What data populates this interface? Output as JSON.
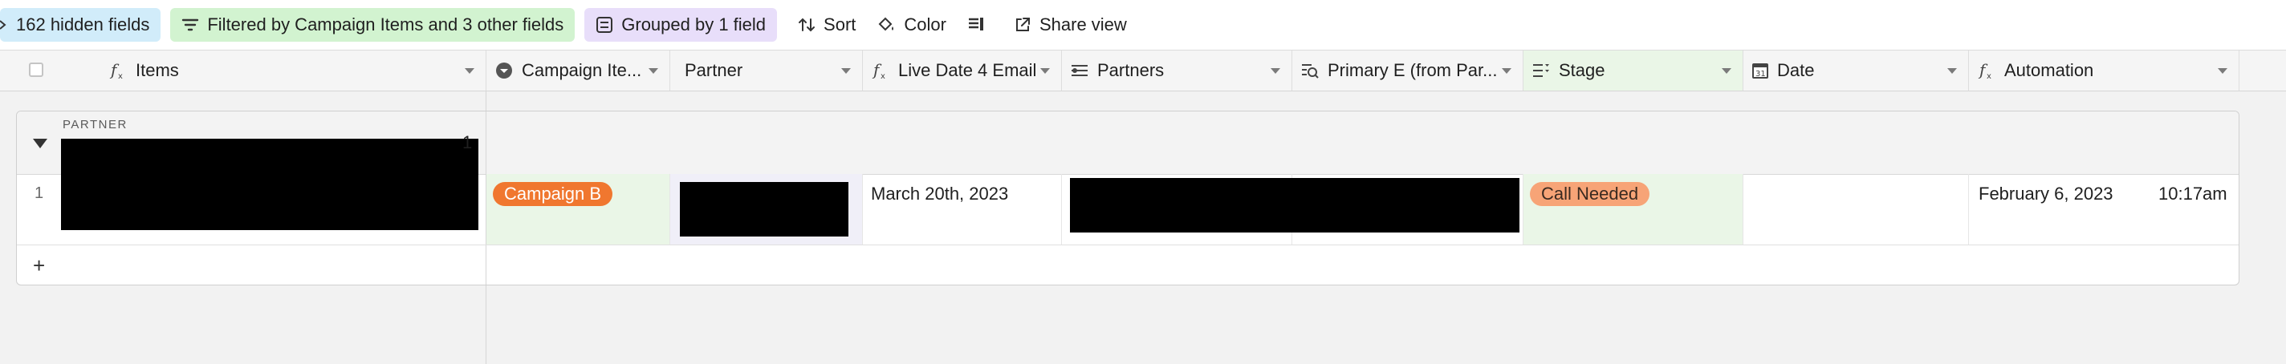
{
  "toolbar": {
    "hidden_fields": "162 hidden fields",
    "filter": "Filtered by Campaign Items and 3 other fields",
    "group": "Grouped by 1 field",
    "sort": "Sort",
    "color": "Color",
    "share": "Share view"
  },
  "columns": [
    {
      "label": "Items",
      "icon": "formula-icon"
    },
    {
      "label": "Campaign Ite...",
      "icon": "dropdown-circle-icon"
    },
    {
      "label": "Partner",
      "icon": ""
    },
    {
      "label": "Live Date 4 Email",
      "icon": "formula-icon"
    },
    {
      "label": "Partners",
      "icon": "linked-records-icon"
    },
    {
      "label": "Primary E (from Par...",
      "icon": "lookup-icon"
    },
    {
      "label": "Stage",
      "icon": "single-select-icon"
    },
    {
      "label": "Date",
      "icon": "calendar-icon"
    },
    {
      "label": "Automation",
      "icon": "formula-icon"
    }
  ],
  "group": {
    "label": "PARTNER",
    "count": "1"
  },
  "row": {
    "number": "1",
    "campaign": "Campaign B",
    "live_date": "March 20th, 2023",
    "stage": "Call Needed",
    "automation_date": "February 6, 2023",
    "automation_time": "10:17am"
  },
  "add_row": "+",
  "colors": {
    "campaign_pill": "#f0772f",
    "stage_pill": "#f7a477",
    "filter_chip": "#d2f3d0",
    "group_chip": "#e8defa",
    "hidden_chip": "#d1ecfa"
  }
}
